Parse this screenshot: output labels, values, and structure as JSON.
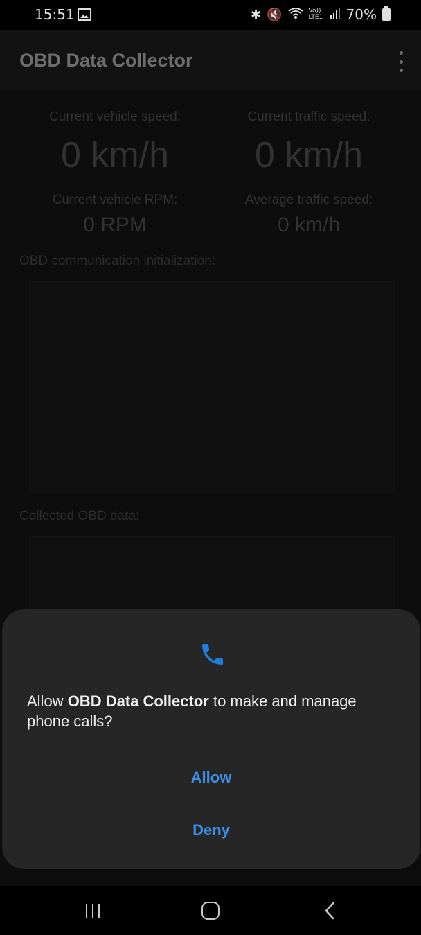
{
  "status_bar": {
    "time": "15:51",
    "battery": "70%",
    "icons": [
      "image-icon",
      "bluetooth-icon",
      "mute-icon",
      "wifi-icon",
      "volte-lte-icon",
      "signal-icon",
      "battery-icon"
    ],
    "volte_text": "Vo)) LTE1"
  },
  "app_bar": {
    "title": "OBD Data Collector"
  },
  "stats": {
    "vehicle_speed_label": "Current vehicle speed:",
    "vehicle_speed_value": "0 km/h",
    "traffic_speed_label": "Current traffic speed:",
    "traffic_speed_value": "0 km/h",
    "vehicle_rpm_label": "Current vehicle RPM:",
    "vehicle_rpm_value": "0 RPM",
    "avg_traffic_speed_label": "Average traffic speed:",
    "avg_traffic_speed_value": "0 km/h"
  },
  "sections": {
    "init_label": "OBD communication initialization:",
    "collected_label": "Collected OBD data:"
  },
  "dialog": {
    "message_prefix": "Allow ",
    "app_name": "OBD Data Collector",
    "message_suffix": " to make and manage phone calls?",
    "allow_label": "Allow",
    "deny_label": "Deny",
    "accent_color": "#3e8ee8"
  }
}
